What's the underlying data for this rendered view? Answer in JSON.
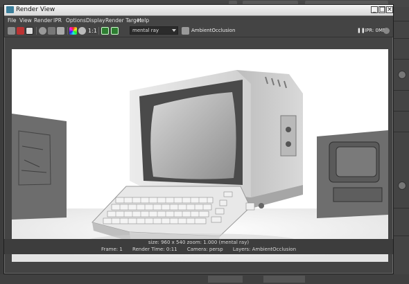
{
  "window": {
    "title": "Render View"
  },
  "menu": [
    "File",
    "View",
    "Render",
    "IPR",
    "Options",
    "Display",
    "Render Target",
    "Help"
  ],
  "toolbar": {
    "ratio_label": "1:1",
    "renderer": "mental ray",
    "layer_name": "AmbientOcclusion",
    "ipr_status": "IPR: 0MB"
  },
  "status": {
    "line1": "size: 960 x 540 zoom: 1.000    (mental ray)",
    "frame": "Frame: 1",
    "render_time": "Render Time: 0:11",
    "camera": "Camera: persp",
    "layers": "Layers: AmbientOcclusion"
  },
  "icons": [
    "render-icon",
    "snapshot-icon",
    "ipr-icon",
    "refresh-icon",
    "region-icon",
    "color-channel-icon",
    "alpha-icon",
    "keep-image-icon",
    "remove-image-icon",
    "layer-icon",
    "pause-icon"
  ]
}
